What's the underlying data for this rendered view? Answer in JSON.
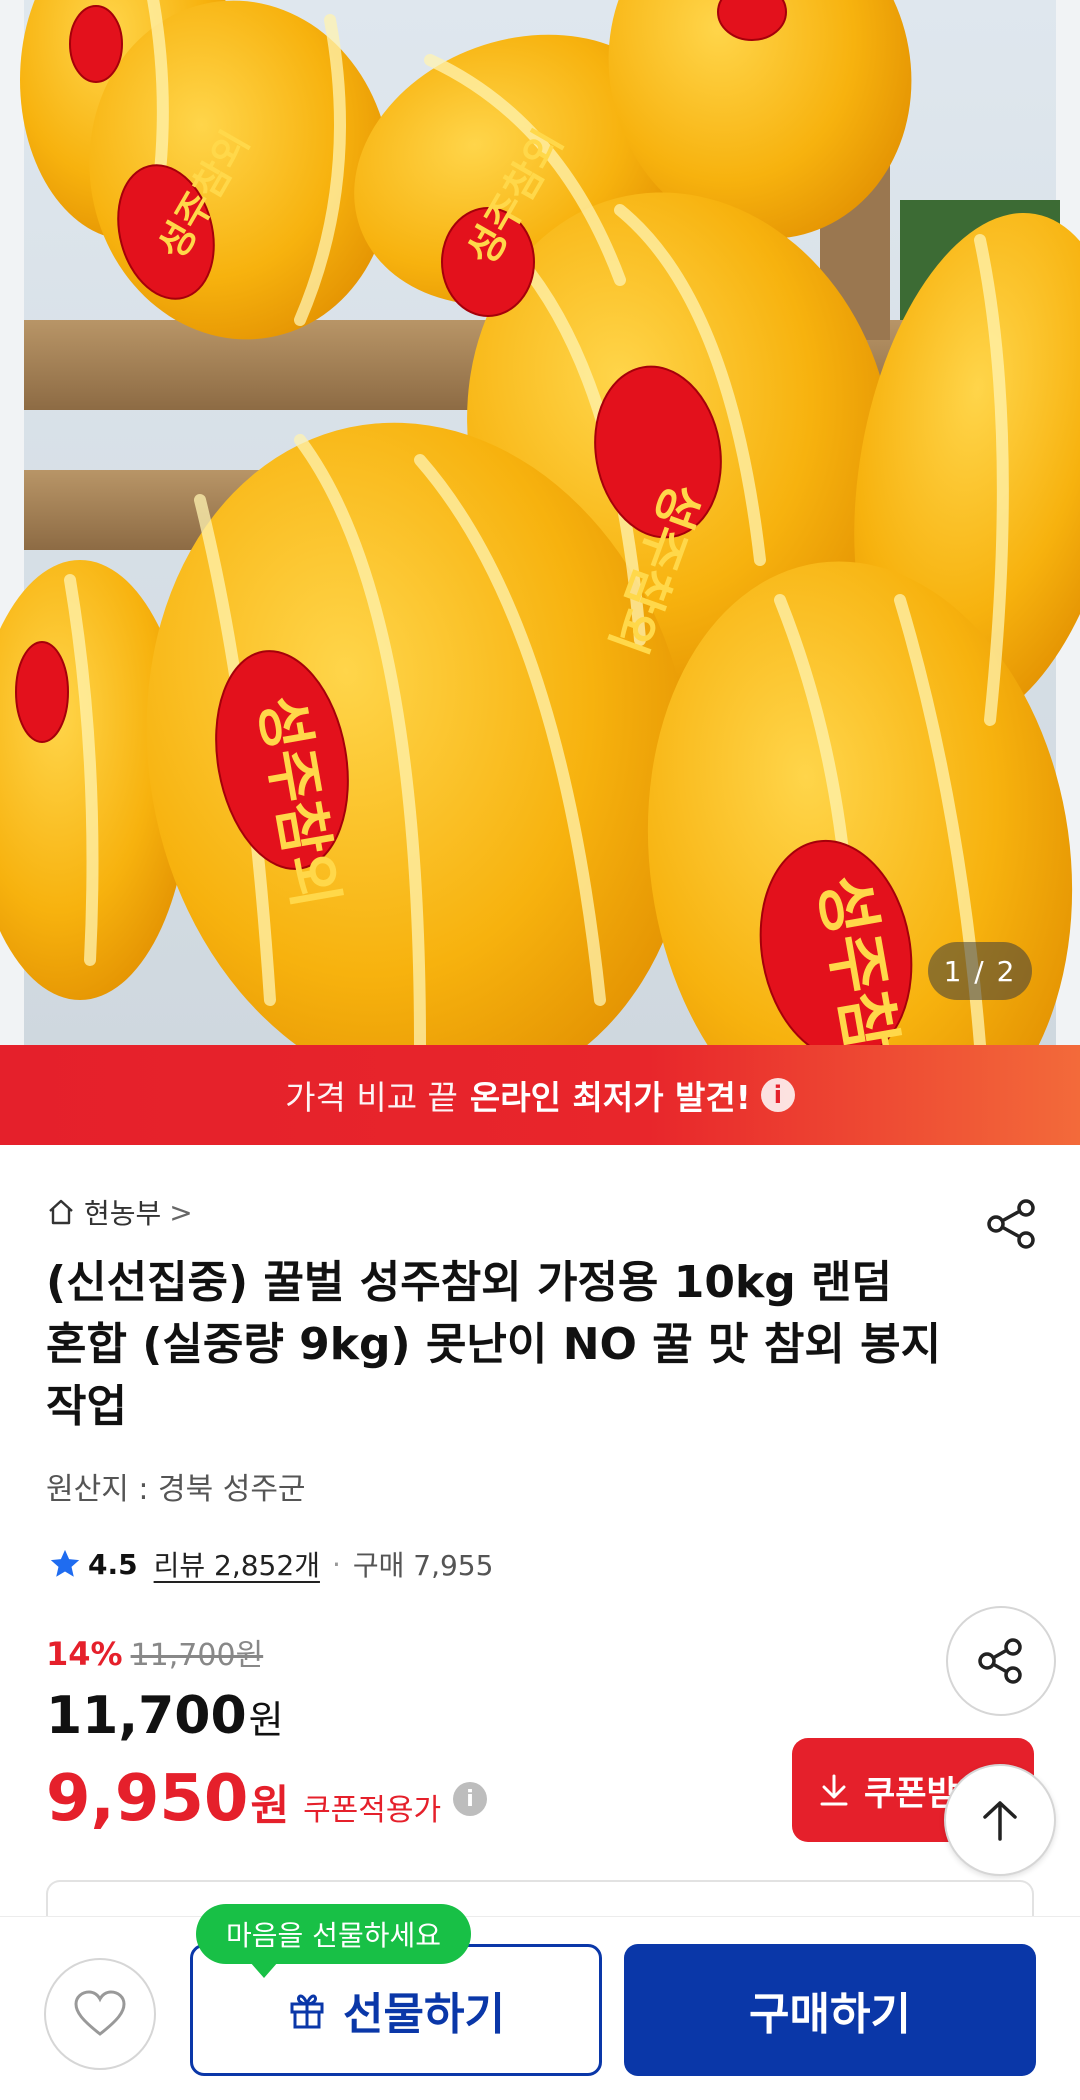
{
  "gallery": {
    "page_indicator": "1 / 2",
    "current_page": 1,
    "total_pages": 2,
    "image_label_text": "성주참외"
  },
  "banner": {
    "text_light": "가격 비교 끝",
    "text_bold": "온라인 최저가 발견!",
    "info_icon": "i"
  },
  "store": {
    "icon": "home-icon",
    "name": "현농부",
    "chevron": ">"
  },
  "product": {
    "title": "(신선집중) 꿀벌 성주참외 가정용 10kg 랜덤 혼합 (실중량 9kg) 못난이 NO 꿀 맛 참외 봉지작업",
    "origin": "원산지 : 경북 성주군"
  },
  "rating": {
    "score": "4.5",
    "review_label": "리뷰 2,852개",
    "dot": "·",
    "purchase_label": "구매 7,955"
  },
  "price": {
    "discount_rate": "14%",
    "original_price": "11,700원",
    "sale_price": "11,700",
    "sale_unit": "원",
    "coupon_price": "9,950",
    "coupon_unit": "원",
    "coupon_label": "쿠폰적용가",
    "coupon_info": "i",
    "coupon_button": "쿠폰받기"
  },
  "bottom": {
    "gift_tooltip": "마음을 선물하세요",
    "gift_button": "선물하기",
    "buy_button": "구매하기"
  },
  "colors": {
    "accent_red": "#e5202b",
    "primary_blue": "#0a37a8",
    "tooltip_green": "#18c046"
  }
}
